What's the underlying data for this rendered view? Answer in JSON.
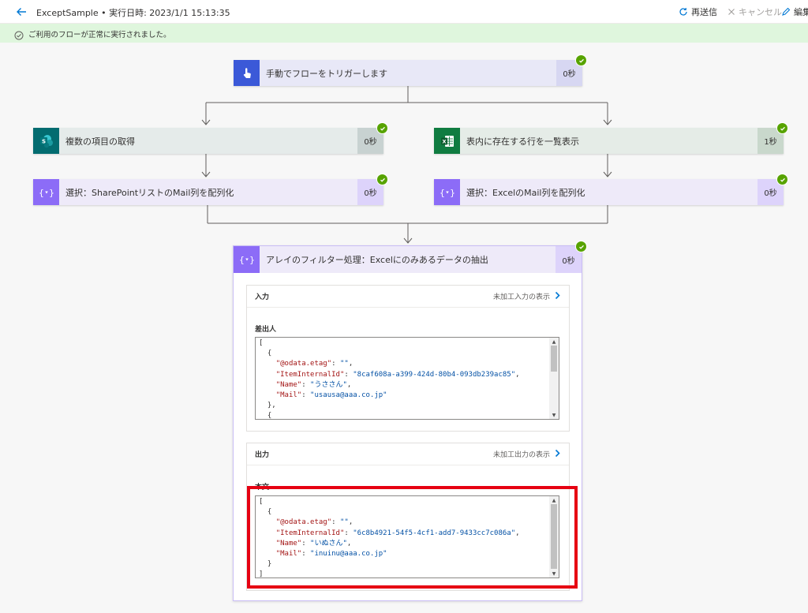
{
  "header": {
    "title": "ExceptSample • 実行日時: 2023/1/1 15:13:35",
    "resubmit_label": "再送信",
    "cancel_label": "キャンセル",
    "edit_label": "編集"
  },
  "banner": {
    "message": "ご利用のフローが正常に実行されました。"
  },
  "steps": {
    "trigger": {
      "label": "手動でフローをトリガーします",
      "duration": "0秒"
    },
    "sharepoint_get_items": {
      "label": "複数の項目の取得",
      "duration": "0秒"
    },
    "excel_list_rows": {
      "label": "表内に存在する行を一覧表示",
      "duration": "1秒"
    },
    "select_sharepoint": {
      "label": "選択：SharePointリストのMail列を配列化",
      "duration": "0秒"
    },
    "select_excel": {
      "label": "選択：ExcelのMail列を配列化",
      "duration": "0秒"
    },
    "filter_array": {
      "label": "アレイのフィルター処理：Excelにのみあるデータの抽出",
      "duration": "0秒"
    }
  },
  "input_section": {
    "title": "入力",
    "raw_link": "未加工入力の表示",
    "field_label": "差出人",
    "code_lines": [
      "[",
      "  {",
      "    \"@odata.etag\": \"\",",
      "    \"ItemInternalId\": \"8caf608a-a399-424d-80b4-093db239ac85\",",
      "    \"Name\": \"うささん\",",
      "    \"Mail\": \"usausa@aaa.co.jp\"",
      "  },",
      "  {"
    ]
  },
  "output_section": {
    "title": "出力",
    "raw_link": "未加工出力の表示",
    "field_label": "本文",
    "code_lines": [
      "[",
      "  {",
      "    \"@odata.etag\": \"\",",
      "    \"ItemInternalId\": \"6c8b4921-54f5-4cf1-add7-9433cc7c086a\",",
      "    \"Name\": \"いぬさん\",",
      "    \"Mail\": \"inuinu@aaa.co.jp\"",
      "  }",
      "]"
    ]
  },
  "colors": {
    "success_green": "#57a300",
    "banner_bg": "#dff6dd",
    "trigger_blue": "#3b59d8",
    "sharepoint_teal": "#036c70",
    "excel_green": "#107c41",
    "data_ops_purple": "#8c6cf7",
    "highlight_red": "#e60012"
  },
  "icons": {
    "back": "arrow-left-icon",
    "resubmit": "refresh-icon",
    "cancel": "close-icon",
    "edit": "pencil-icon",
    "success": "check-circle-icon",
    "trigger": "touch-hand-icon",
    "sharepoint": "sharepoint-icon",
    "excel": "excel-icon",
    "data_operation": "curly-braces-icon",
    "expand": "chevron-right-icon"
  }
}
